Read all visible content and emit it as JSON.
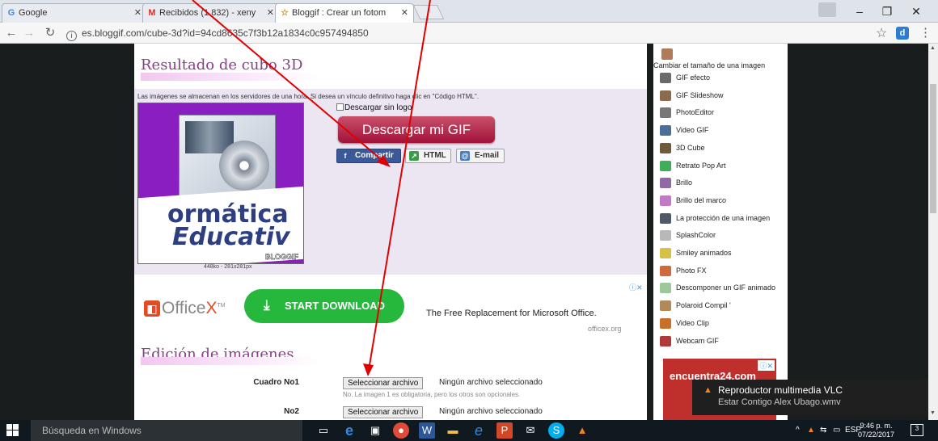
{
  "browser": {
    "tabs": [
      {
        "label": "Google",
        "favicon": "G"
      },
      {
        "label": "Recibidos (1.832) - xeny",
        "favicon": "M"
      },
      {
        "label": "Bloggif : Crear un fotom",
        "favicon": "☆"
      }
    ],
    "url": "es.bloggif.com/cube-3d?id=94cd8635c7f3b12a1834c0c957494850"
  },
  "content": {
    "result_title": "Resultado de cubo 3D",
    "storage_note": "Las imágenes se almacenan en los servidores de una hora. Si desea un vínculo definitivo haga clic en \"Código HTML\".",
    "gif": {
      "text_line1": "ormática",
      "text_line2": "Educativ",
      "watermark": "BLOGGIF",
      "info": "448ko - 281x281px"
    },
    "no_logo_label": "Descargar sin logo",
    "download_button": "Descargar mi GIF",
    "share_buttons": [
      "Compartir",
      "HTML",
      "E-mail"
    ],
    "ad": {
      "brand": "Office",
      "brand_accent": "X",
      "tm": "TM",
      "cta": "START DOWNLOAD",
      "tagline": "The Free Replacement for Microsoft Office.",
      "url": "officex.org"
    },
    "edit_title": "Edición de imágenes",
    "fields": [
      {
        "label": "Cuadro No1",
        "button": "Seleccionar archivo",
        "status": "Ningún archivo seleccionado"
      },
      {
        "label": "No2",
        "button": "Seleccionar archivo",
        "status": "Ningún archivo seleccionado"
      }
    ],
    "field_hint": "No. La imagen 1 es obligatoria, pero los otros son opcionales."
  },
  "sidebar": {
    "head": "Cambiar el tamaño de una imagen",
    "items": [
      {
        "label": "GIF efecto",
        "icon": "effect-icon",
        "color": "#6a6a6a"
      },
      {
        "label": "GIF Slideshow",
        "icon": "slideshow-icon",
        "color": "#8a6b4c"
      },
      {
        "label": "PhotoEditor",
        "icon": "photoeditor-icon",
        "color": "#777777"
      },
      {
        "label": "Video GIF",
        "icon": "video-gif-icon",
        "color": "#4c6f9a"
      },
      {
        "label": "3D Cube",
        "icon": "cube-icon",
        "color": "#6f5a3a"
      },
      {
        "label": "Retrato Pop Art",
        "icon": "pop-art-icon",
        "color": "#3fae58"
      },
      {
        "label": "Brillo",
        "icon": "brillo-icon",
        "color": "#8f6aa3"
      },
      {
        "label": "Brillo del marco",
        "icon": "frame-brillo-icon",
        "color": "#c07bc4"
      },
      {
        "label": "La protección de una imagen",
        "icon": "protection-icon",
        "color": "#505a66"
      },
      {
        "label": "SplashColor",
        "icon": "splash-icon",
        "color": "#b8b8b8"
      },
      {
        "label": "Smiley animados",
        "icon": "smiley-icon",
        "color": "#d7c046"
      },
      {
        "label": "Photo FX",
        "icon": "photo-fx-icon",
        "color": "#cf6b3a"
      },
      {
        "label": "Descomponer un GIF animado",
        "icon": "decompose-icon",
        "color": "#9ec79a"
      },
      {
        "label": "Polaroid Compil '",
        "icon": "polaroid-icon",
        "color": "#b08a5a"
      },
      {
        "label": "Video Clip",
        "icon": "video-clip-icon",
        "color": "#c8702a"
      },
      {
        "label": "Webcam GIF",
        "icon": "webcam-icon",
        "color": "#b03a3a"
      }
    ],
    "ad_logo": "encuentra24.com"
  },
  "notification": {
    "title": "Reproductor multimedia VLC",
    "subtitle": "Estar Contigo  Alex Ubago.wmv"
  },
  "taskbar": {
    "search_placeholder": "Búsqueda en Windows",
    "language": "ESP",
    "time": "9:46 p. m.",
    "date": "07/22/2017",
    "notif_count": "3"
  },
  "colors": {
    "accent_title": "#8b3d8b",
    "download_button": "#a2123a",
    "annotation_arrow": "#e00000"
  }
}
